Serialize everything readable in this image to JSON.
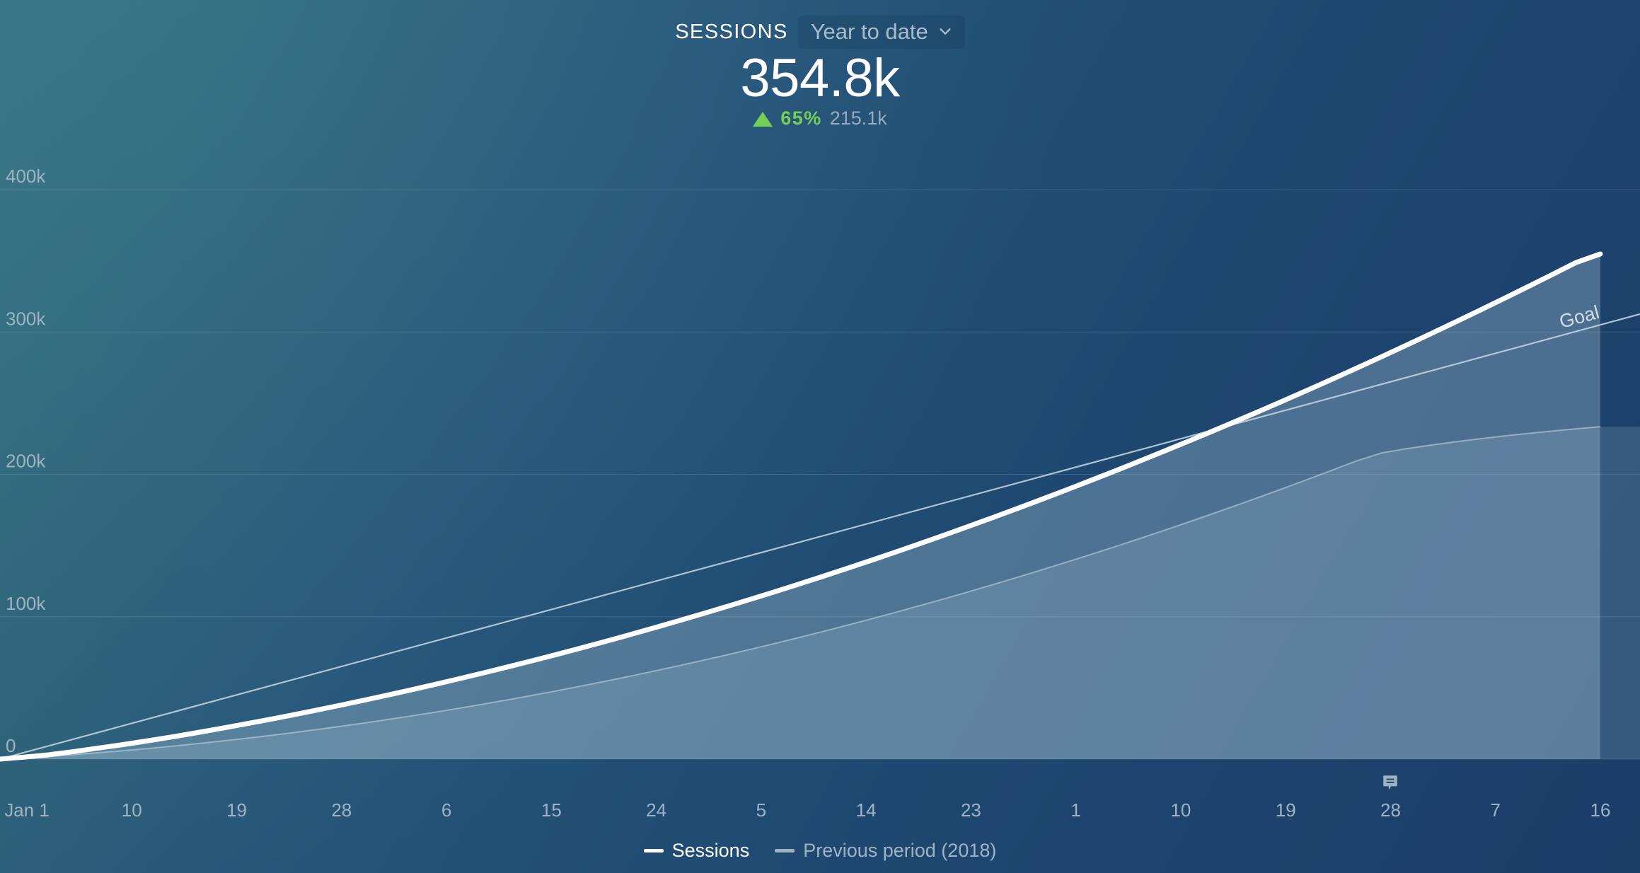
{
  "header": {
    "metric_title": "SESSIONS",
    "date_range": "Year to date",
    "chevron_icon": "chevron-down-icon",
    "big_value": "354.8k",
    "delta_direction_icon": "triangle-up-icon",
    "delta_percent": "65%",
    "delta_previous_value": "215.1k",
    "positive_color": "#76cf55"
  },
  "legend": {
    "items": [
      {
        "label": "Sessions",
        "color": "#ffffff"
      },
      {
        "label": "Previous period (2018)",
        "color": "#9fb4c3"
      }
    ]
  },
  "annotation": {
    "icon": "comment-icon",
    "x_label": "28"
  },
  "chart_data": {
    "type": "area",
    "title": "SESSIONS",
    "subtitle": "Year to date",
    "xlabel": "",
    "ylabel": "",
    "grid": true,
    "legend_position": "bottom-center",
    "ylim": [
      0,
      400000
    ],
    "yticks": [
      0,
      100000,
      200000,
      300000,
      400000
    ],
    "ytick_labels": [
      "0",
      "100k",
      "200k",
      "300k",
      "400k"
    ],
    "xtick_labels": [
      "Jan 1",
      "10",
      "19",
      "28",
      "6",
      "15",
      "24",
      "5",
      "14",
      "23",
      "1",
      "10",
      "19",
      "28",
      "7",
      "16"
    ],
    "annotations": [
      {
        "text": "Goal",
        "at_x_index": 15,
        "value": 300000
      }
    ],
    "series": [
      {
        "name": "Sessions",
        "color": "#ffffff",
        "fill": "rgba(190,214,230,0.30)",
        "values": [
          0,
          1400,
          3000,
          5200,
          7600,
          10000,
          12600,
          15300,
          18200,
          21200,
          24300,
          27500,
          30800,
          34200,
          37700,
          41300,
          45000,
          48800,
          52700,
          56700,
          60800,
          65000,
          69300,
          73700,
          78200,
          82800,
          87500,
          92300,
          97200,
          102200,
          107300,
          112500,
          117800,
          123200,
          128700,
          134300,
          140000,
          145800,
          151700,
          157700,
          163800,
          170000,
          176300,
          182700,
          189200,
          195800,
          202500,
          209300,
          216200,
          223200,
          230300,
          237500,
          244800,
          252200,
          259700,
          267300,
          275000,
          282800,
          290700,
          298700,
          306800,
          315000,
          323300,
          331700,
          340200,
          348800,
          354800
        ]
      },
      {
        "name": "Previous period (2018)",
        "color": "#9fb4c3",
        "fill": "rgba(160,190,212,0.20)",
        "values": [
          0,
          900,
          1900,
          3100,
          4400,
          5800,
          7300,
          8900,
          10600,
          12400,
          14300,
          16300,
          18400,
          20600,
          22900,
          25300,
          27800,
          30400,
          33100,
          35900,
          38800,
          41800,
          44900,
          48100,
          51400,
          54800,
          58300,
          61900,
          65600,
          69400,
          73300,
          77300,
          81400,
          85600,
          89900,
          94300,
          98800,
          103400,
          108100,
          112900,
          117800,
          122800,
          127900,
          133100,
          138400,
          143800,
          149300,
          154900,
          160600,
          166400,
          172300,
          178300,
          184400,
          190600,
          196900,
          203300,
          209800,
          215100,
          218000,
          220500,
          222800,
          224900,
          226900,
          228700,
          230400,
          232000,
          233500
        ]
      }
    ],
    "goal_line": {
      "name": "Goal",
      "color": "#c9d8e3",
      "start_value": 0,
      "end_value": 305000
    }
  }
}
